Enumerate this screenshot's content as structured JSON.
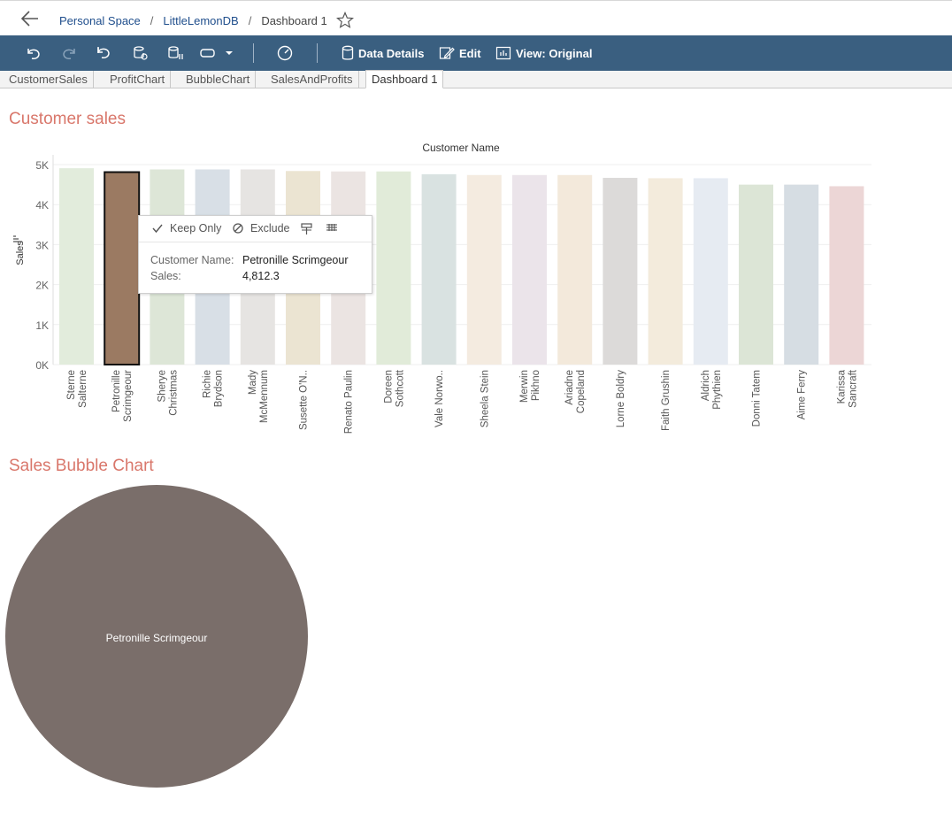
{
  "breadcrumb": {
    "items": [
      "Personal Space",
      "LittleLemonDB",
      "Dashboard 1"
    ]
  },
  "toolbar": {
    "data_details": "Data Details",
    "edit": "Edit",
    "view": "View: Original"
  },
  "tabs": [
    "CustomerSales",
    "ProfitChart",
    "BubbleChart",
    "SalesAndProfits",
    "Dashboard 1"
  ],
  "active_tab": "Dashboard 1",
  "sections": {
    "customer_sales_title": "Customer sales",
    "bubble_title": "Sales Bubble Chart"
  },
  "tooltip": {
    "keep_only": "Keep Only",
    "exclude": "Exclude",
    "name_label": "Customer Name:",
    "name_value": "Petronille Scrimgeour",
    "sales_label": "Sales:",
    "sales_value": "4,812.3"
  },
  "colors": {
    "title": "#d9776b",
    "toolbar": "#3a5f80",
    "selected_bar": "#9b7a62",
    "bubble": "#7a6e6a"
  },
  "chart_data": [
    {
      "type": "bar",
      "title": "Customer sales",
      "xlabel": "Customer Name",
      "ylabel": "Sales",
      "ylim": [
        0,
        5000
      ],
      "yticks": [
        "0K",
        "1K",
        "2K",
        "3K",
        "4K",
        "5K"
      ],
      "categories": [
        [
          "Sterne",
          "Salterne"
        ],
        [
          "Petronille",
          "Scrimgeour"
        ],
        [
          "Sherye",
          "Christmas"
        ],
        [
          "Richie",
          "Brydson"
        ],
        [
          "Mady",
          "McMennum"
        ],
        [
          "Susette O'N.."
        ],
        [
          "Renato Paulin"
        ],
        [
          "Doreen",
          "Sothcott"
        ],
        [
          "Vale Norwo.."
        ],
        [
          "Sheela Stein"
        ],
        [
          "Merwin",
          "Pikhno"
        ],
        [
          "Ariadne",
          "Copeland"
        ],
        [
          "Lorne Boldry"
        ],
        [
          "Faith Grushin"
        ],
        [
          "Aldrich",
          "Phythien"
        ],
        [
          "Donni Tatem"
        ],
        [
          "Aime Ferry"
        ],
        [
          "Karissa",
          "Sancraft"
        ]
      ],
      "values": [
        4910,
        4812.3,
        4880,
        4880,
        4880,
        4840,
        4830,
        4830,
        4760,
        4740,
        4740,
        4740,
        4670,
        4660,
        4660,
        4500,
        4500,
        4460
      ],
      "colors": [
        "#e2ecdc",
        "#9b7a62",
        "#dde6d7",
        "#d8dfe6",
        "#e6e4e2",
        "#ebe4d2",
        "#ebe4e2",
        "#e1ebd9",
        "#d9e2e1",
        "#f4ebe0",
        "#ebe4ea",
        "#f3e9db",
        "#dcdad9",
        "#f3ebdc",
        "#e6ebf2",
        "#dce5d6",
        "#d6dde3",
        "#ecd6d6"
      ],
      "selected_index": 1
    },
    {
      "type": "bubble",
      "title": "Sales Bubble Chart",
      "labels": [
        "Petronille Scrimgeour"
      ],
      "values": [
        4812.3
      ]
    }
  ]
}
